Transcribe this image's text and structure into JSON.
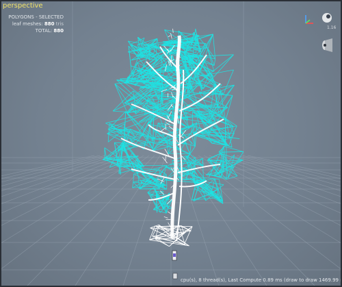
{
  "viewport": {
    "label": "perspective",
    "stats": {
      "heading": "POLYGONS - SELECTED",
      "leaf_label": "leaf meshes:",
      "leaf_value": "880",
      "leaf_unit": "tris",
      "total_label": "TOTAL:",
      "total_value": "880"
    },
    "zoom": "1.16",
    "status": "cpu(s), 8 thread(s), Last Compute 0.89 ms (draw to draw 1469.99 ms)"
  },
  "colors": {
    "background": "#7a8896",
    "grid": "#9aa6b3",
    "leaves": "#1ee3e3",
    "trunk": "#ffffff",
    "label": "#f2e36a"
  },
  "icons": {
    "axis": "axis-gizmo-icon",
    "camera": "camera-orbit-icon",
    "light": "light-direction-icon",
    "object": "object-marker-icon"
  }
}
